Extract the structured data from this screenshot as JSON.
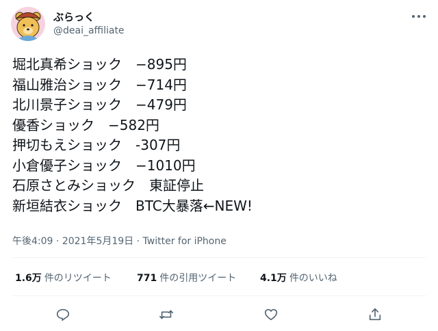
{
  "author": {
    "name": "ぶらっく",
    "handle": "@deai_affiliate"
  },
  "tweet": {
    "lines": [
      "堀北真希ショック　−895円",
      "福山雅治ショック　−714円",
      "北川景子ショック　−479円",
      "優香ショック　−582円",
      "押切もえショック　-307円",
      "小倉優子ショック　−1010円",
      "石原さとみショック　東証停止",
      "新垣結衣ショック　BTC大暴落←NEW!"
    ],
    "time": "午後4:09",
    "separator1": " · ",
    "date": "2021年5月19日",
    "separator2": " · ",
    "source": "Twitter for iPhone"
  },
  "stats": {
    "retweets_count": "1.6万",
    "retweets_label": "件のリツイート",
    "quotes_count": "771",
    "quotes_label": "件の引用ツイート",
    "likes_count": "4.1万",
    "likes_label": "件のいいね"
  },
  "icons": {
    "avatar": "bear-avatar",
    "more": "more-icon",
    "reply": "reply-icon",
    "retweet": "retweet-icon",
    "like": "heart-icon",
    "share": "share-icon"
  },
  "colors": {
    "text": "#0f1419",
    "secondary": "#536471",
    "divider": "#eff3f4",
    "avatar_bg": "#f6d2df"
  }
}
